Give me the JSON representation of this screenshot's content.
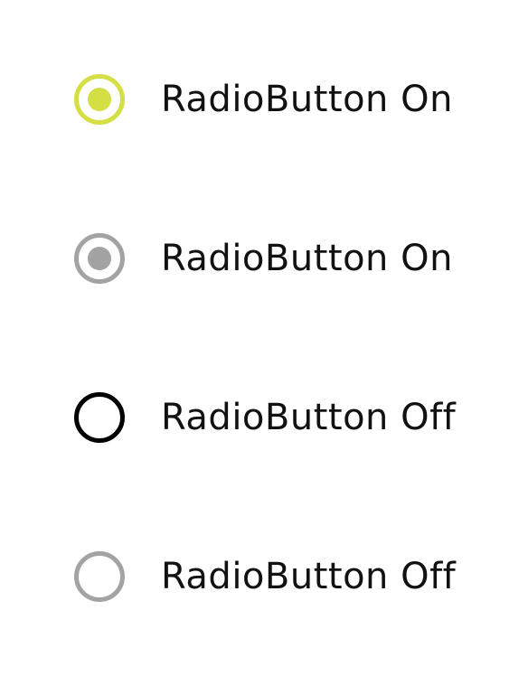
{
  "radios": [
    {
      "label": "RadioButton On",
      "checked": true,
      "enabled": true,
      "color": "#d4df46"
    },
    {
      "label": "RadioButton On",
      "checked": true,
      "enabled": false,
      "color": "#a3a3a3"
    },
    {
      "label": "RadioButton Off",
      "checked": false,
      "enabled": true,
      "color": "#000000"
    },
    {
      "label": "RadioButton Off",
      "checked": false,
      "enabled": false,
      "color": "#a3a3a3"
    }
  ]
}
